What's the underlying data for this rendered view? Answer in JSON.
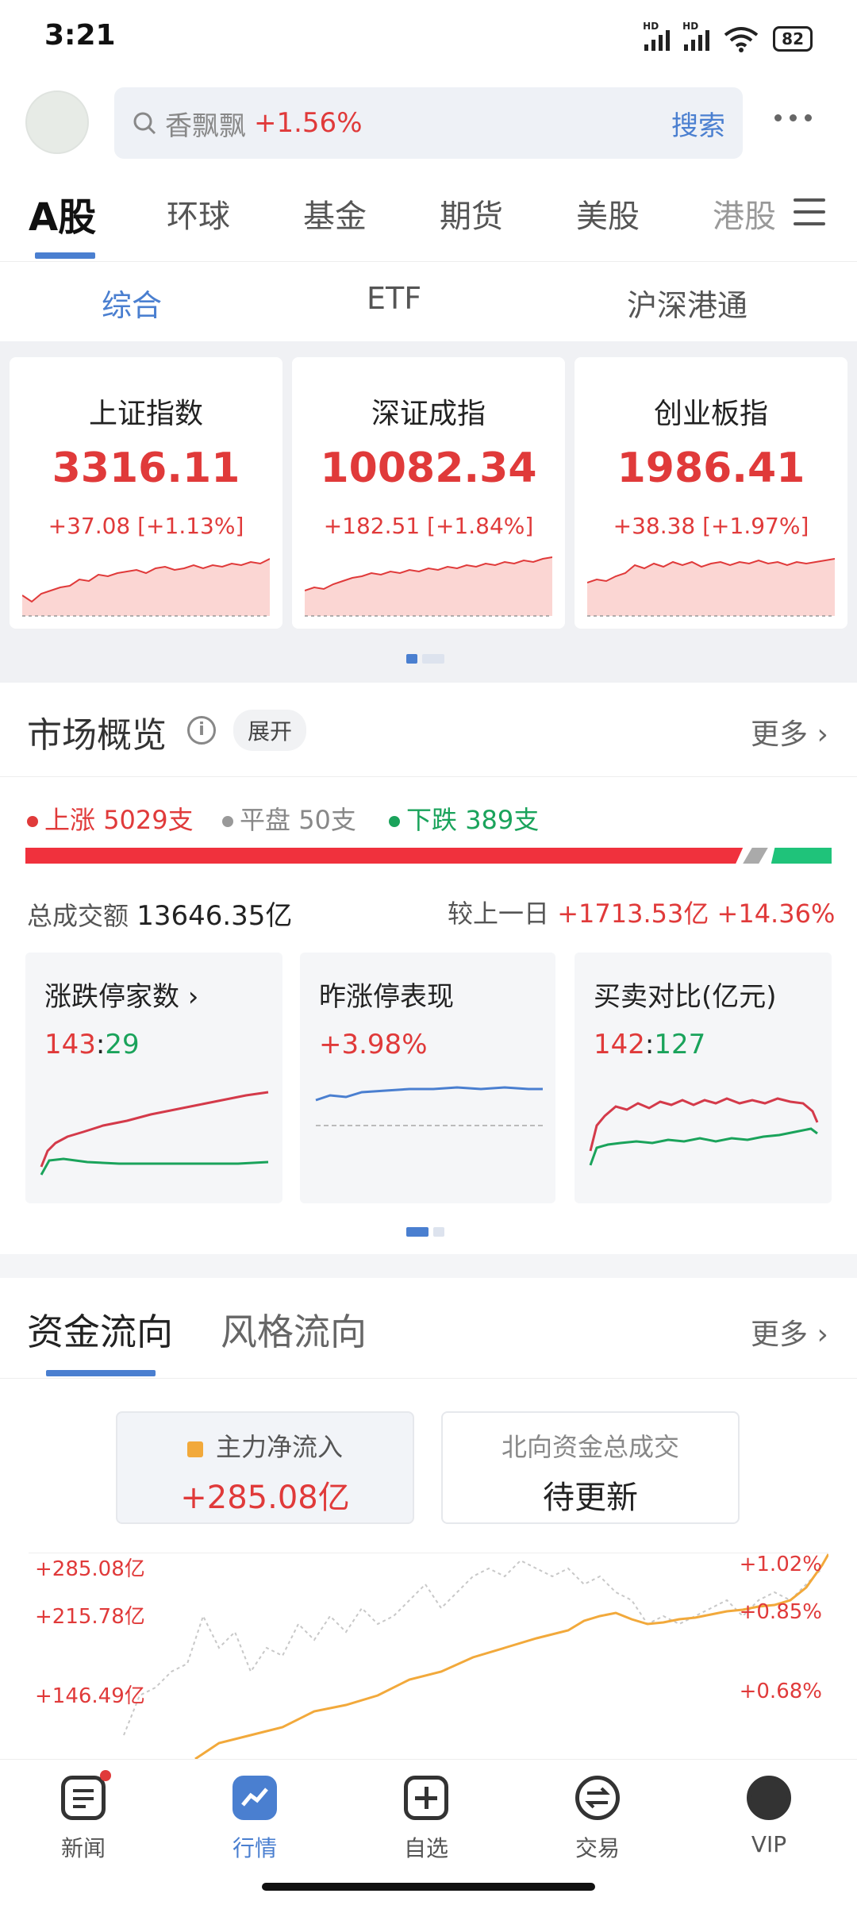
{
  "status": {
    "time": "3:21",
    "battery": "82",
    "hd1": "HD",
    "hd2": "HD"
  },
  "search": {
    "placeholder": "香飘飘",
    "change": "+1.56%",
    "button": "搜索"
  },
  "market_tabs": [
    "A股",
    "环球",
    "基金",
    "期货",
    "美股",
    "港股"
  ],
  "sub_tabs": [
    "综合",
    "ETF",
    "沪深港通"
  ],
  "indices": [
    {
      "name": "上证指数",
      "value": "3316.11",
      "change": "+37.08 [+1.13%]"
    },
    {
      "name": "深证成指",
      "value": "10082.34",
      "change": "+182.51 [+1.84%]"
    },
    {
      "name": "创业板指",
      "value": "1986.41",
      "change": "+38.38 [+1.97%]"
    }
  ],
  "overview": {
    "title": "市场概览",
    "expand": "展开",
    "more": "更多",
    "up_label": "上涨",
    "up_count": "5029支",
    "flat_label": "平盘",
    "flat_count": "50支",
    "down_label": "下跌",
    "down_count": "389支",
    "up_ratio": 0.9,
    "turnover_label": "总成交额",
    "turnover_value": "13646.35亿",
    "compare_label": "较上一日",
    "compare_value": "+1713.53亿",
    "compare_pct": "+14.36%",
    "mini_cards": [
      {
        "title": "涨跌停家数",
        "val_a": "143",
        "sep": ":",
        "val_b": "29"
      },
      {
        "title": "昨涨停表现",
        "value": "+3.98%"
      },
      {
        "title": "买卖对比(亿元)",
        "val_a": "142",
        "sep": ":",
        "val_b": "127"
      }
    ]
  },
  "flow": {
    "tabs": [
      "资金流向",
      "风格流向"
    ],
    "more": "更多",
    "main_label": "主力净流入",
    "main_value": "+285.08亿",
    "north_label": "北向资金总成交",
    "north_value": "待更新",
    "y_left": [
      "+285.08亿",
      "+215.78亿",
      "+146.49亿"
    ],
    "y_right": [
      "+1.02%",
      "+0.85%",
      "+0.68%"
    ]
  },
  "nav": [
    "新闻",
    "行情",
    "自选",
    "交易",
    "VIP"
  ],
  "colors": {
    "up": "#e03a3a",
    "down": "#1aa35b",
    "accent": "#4a7fd0",
    "flow": "#f2a93b"
  }
}
